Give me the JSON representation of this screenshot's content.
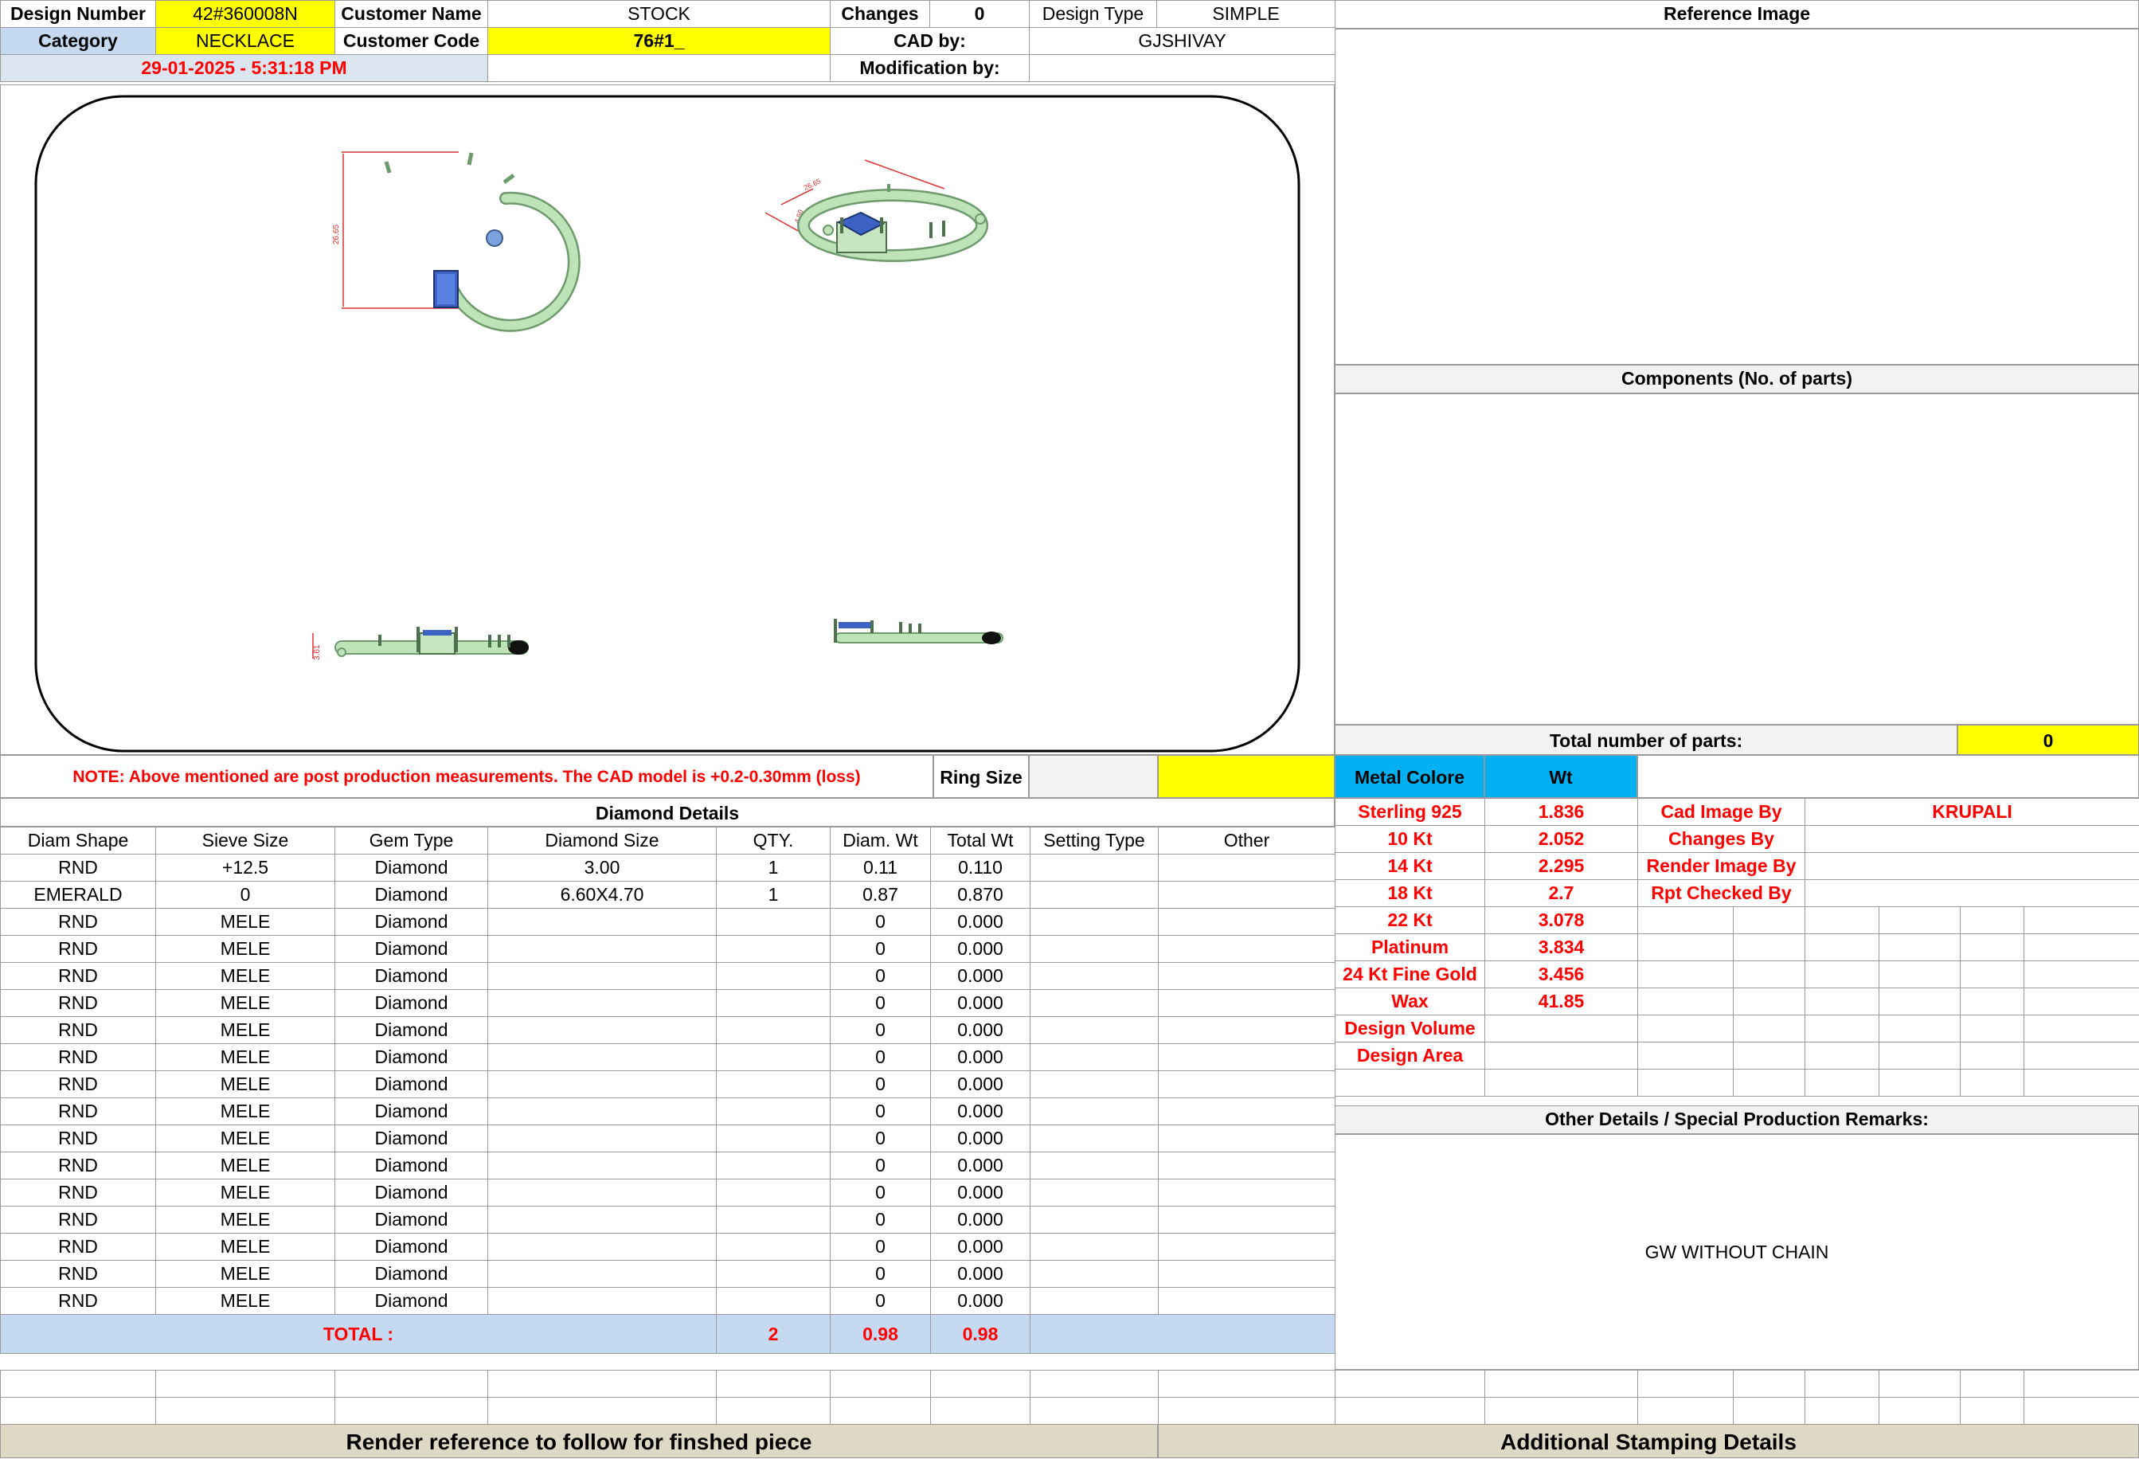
{
  "header": {
    "design_number_label": "Design Number",
    "design_number": "42#360008N",
    "customer_name_label": "Customer Name",
    "customer_name": "STOCK",
    "changes_label": "Changes",
    "changes": "0",
    "design_type_label": "Design Type",
    "design_type": "SIMPLE",
    "category_label": "Category",
    "category": "NECKLACE",
    "customer_code_label": "Customer Code",
    "customer_code": "76#1_",
    "cad_by_label": "CAD by:",
    "cad_by": "GJSHIVAY",
    "timestamp": "29-01-2025 - 5:31:18 PM",
    "modification_by_label": "Modification by:",
    "modification_by": ""
  },
  "drawing": {
    "dim_top_height": "26.65",
    "dim_iso_width": "26.65",
    "dim_iso_height": "4.50",
    "dim_side_height": "3.61"
  },
  "note": {
    "text": "NOTE: Above mentioned are post production measurements. The CAD model is +0.2-0.30mm (loss)",
    "ring_size_label": "Ring Size",
    "ring_size": ""
  },
  "right_panel": {
    "reference_image_label": "Reference Image",
    "components_label": "Components (No. of parts)",
    "total_parts_label": "Total number of parts:",
    "total_parts": "0",
    "metal_color_label": "Metal Colore",
    "wt_label": "Wt",
    "metals": [
      {
        "name": "Sterling 925",
        "wt": "1.836"
      },
      {
        "name": "10 Kt",
        "wt": "2.052"
      },
      {
        "name": "14 Kt",
        "wt": "2.295"
      },
      {
        "name": "18 Kt",
        "wt": "2.7"
      },
      {
        "name": "22 Kt",
        "wt": "3.078"
      },
      {
        "name": "Platinum",
        "wt": "3.834"
      },
      {
        "name": "24 Kt Fine Gold",
        "wt": "3.456"
      },
      {
        "name": "Wax",
        "wt": "41.85"
      },
      {
        "name": "Design Volume",
        "wt": ""
      },
      {
        "name": "Design Area",
        "wt": ""
      }
    ],
    "roles": [
      {
        "label": "Cad Image By",
        "value": "KRUPALI"
      },
      {
        "label": "Changes By",
        "value": ""
      },
      {
        "label": "Render Image By",
        "value": ""
      },
      {
        "label": "Rpt Checked By",
        "value": ""
      }
    ],
    "other_details_label": "Other Details / Special Production Remarks:",
    "other_details": "GW WITHOUT CHAIN"
  },
  "diamond": {
    "title": "Diamond Details",
    "columns": [
      "Diam Shape",
      "Sieve Size",
      "Gem Type",
      "Diamond Size",
      "QTY.",
      "Diam. Wt",
      "Total Wt",
      "Setting Type",
      "Other"
    ],
    "rows": [
      [
        "RND",
        "+12.5",
        "Diamond",
        "3.00",
        "1",
        "0.11",
        "0.110",
        "",
        ""
      ],
      [
        "EMERALD",
        "0",
        "Diamond",
        "6.60X4.70",
        "1",
        "0.87",
        "0.870",
        "",
        ""
      ],
      [
        "RND",
        "MELE",
        "Diamond",
        "",
        "",
        "0",
        "0.000",
        "",
        ""
      ],
      [
        "RND",
        "MELE",
        "Diamond",
        "",
        "",
        "0",
        "0.000",
        "",
        ""
      ],
      [
        "RND",
        "MELE",
        "Diamond",
        "",
        "",
        "0",
        "0.000",
        "",
        ""
      ],
      [
        "RND",
        "MELE",
        "Diamond",
        "",
        "",
        "0",
        "0.000",
        "",
        ""
      ],
      [
        "RND",
        "MELE",
        "Diamond",
        "",
        "",
        "0",
        "0.000",
        "",
        ""
      ],
      [
        "RND",
        "MELE",
        "Diamond",
        "",
        "",
        "0",
        "0.000",
        "",
        ""
      ],
      [
        "RND",
        "MELE",
        "Diamond",
        "",
        "",
        "0",
        "0.000",
        "",
        ""
      ],
      [
        "RND",
        "MELE",
        "Diamond",
        "",
        "",
        "0",
        "0.000",
        "",
        ""
      ],
      [
        "RND",
        "MELE",
        "Diamond",
        "",
        "",
        "0",
        "0.000",
        "",
        ""
      ],
      [
        "RND",
        "MELE",
        "Diamond",
        "",
        "",
        "0",
        "0.000",
        "",
        ""
      ],
      [
        "RND",
        "MELE",
        "Diamond",
        "",
        "",
        "0",
        "0.000",
        "",
        ""
      ],
      [
        "RND",
        "MELE",
        "Diamond",
        "",
        "",
        "0",
        "0.000",
        "",
        ""
      ],
      [
        "RND",
        "MELE",
        "Diamond",
        "",
        "",
        "0",
        "0.000",
        "",
        ""
      ],
      [
        "RND",
        "MELE",
        "Diamond",
        "",
        "",
        "0",
        "0.000",
        "",
        ""
      ],
      [
        "RND",
        "MELE",
        "Diamond",
        "",
        "",
        "0",
        "0.000",
        "",
        ""
      ]
    ],
    "total_label": "TOTAL :",
    "total_qty": "2",
    "total_diam_wt": "0.98",
    "total_wt": "0.98"
  },
  "footer": {
    "render_ref": "Render reference to follow for finshed piece",
    "stamping": "Additional Stamping Details"
  }
}
